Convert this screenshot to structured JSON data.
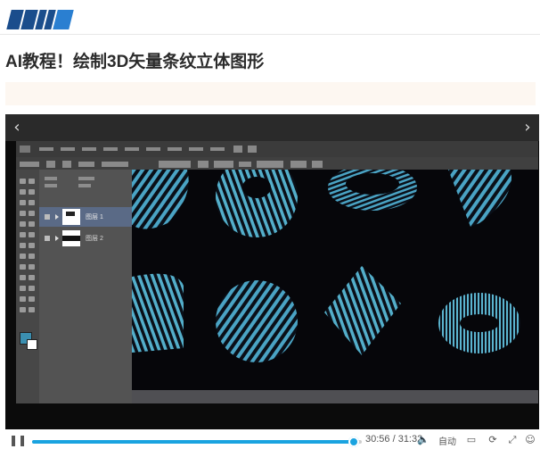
{
  "site": {
    "logo_name": "site-logo"
  },
  "article": {
    "title": "AI教程！绘制3D矢量条纹立体图形"
  },
  "player": {
    "prev_icon": "chevron-left-icon",
    "next_icon": "chevron-right-icon",
    "progress_fraction": 0.975,
    "time_label": "30:56 / 31:32",
    "quality_label": "自动",
    "colors": {
      "accent": "#1aa3e0",
      "stripe": "#4aa3c4",
      "canvas": "#06060a"
    }
  },
  "app": {
    "layers": [
      {
        "name": "图层 1"
      },
      {
        "name": "图层 2"
      }
    ]
  }
}
